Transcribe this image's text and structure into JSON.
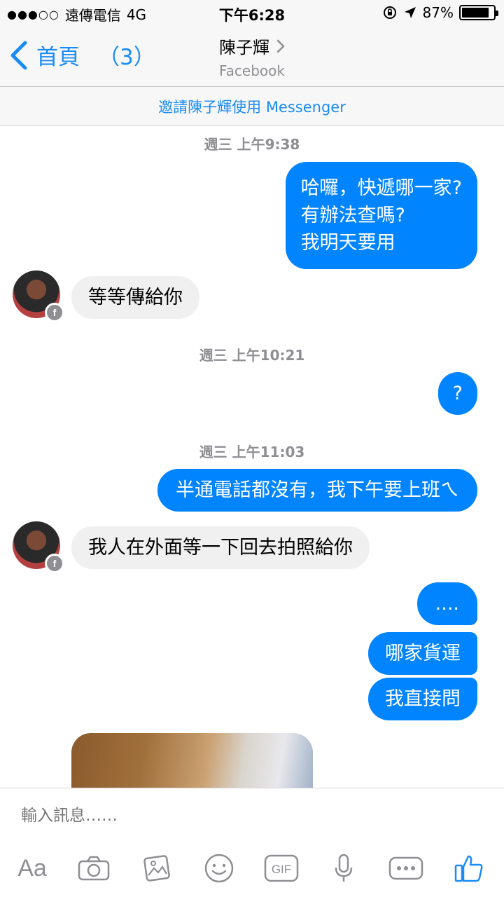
{
  "status_bar": {
    "signal": "●●●○○",
    "carrier": "遠傳電信",
    "network": "4G",
    "time": "下午6:28",
    "battery_percent": "87%",
    "battery_level": 0.87
  },
  "nav": {
    "back_label": "首頁",
    "back_count": "（3）",
    "title": "陳子輝",
    "subtitle": "Facebook"
  },
  "invite_banner": "邀請陳子輝使用 Messenger",
  "messages": [
    {
      "type": "timestamp",
      "text": "週三 上午9:38"
    },
    {
      "type": "out",
      "lines": [
        "哈囉，快遞哪一家?",
        "有辦法查嗎?",
        "我明天要用"
      ]
    },
    {
      "type": "in",
      "text": "等等傳給你"
    },
    {
      "type": "timestamp",
      "text": "週三 上午10:21"
    },
    {
      "type": "out",
      "text": "?"
    },
    {
      "type": "timestamp",
      "text": "週三 上午11:03"
    },
    {
      "type": "out",
      "text": "半通電話都沒有，我下午要上班ㄟ"
    },
    {
      "type": "in",
      "text": "我人在外面等一下回去拍照給你"
    },
    {
      "type": "out",
      "text": "...."
    },
    {
      "type": "out",
      "text": "哪家貨運"
    },
    {
      "type": "out",
      "text": "我直接問"
    }
  ],
  "composer": {
    "placeholder": "輸入訊息……",
    "aa_label": "Aa",
    "gif_label": "GIF",
    "tools": [
      "aa-icon",
      "camera-icon",
      "photo-icon",
      "emoji-icon",
      "gif-icon",
      "microphone-icon",
      "more-icon",
      "thumbs-up-icon"
    ]
  },
  "colors": {
    "accent": "#0084ff",
    "link": "#1a8cf5",
    "incoming_bubble": "#f0f0f0",
    "muted": "#8e8e93"
  }
}
